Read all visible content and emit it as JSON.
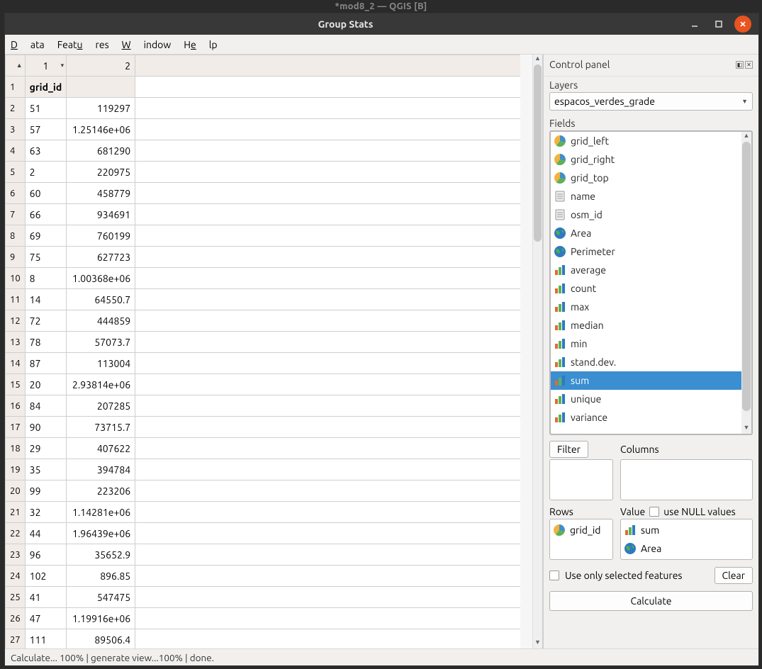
{
  "outer_title": "*mod8_2 — QGIS [B]",
  "window_title": "Group Stats",
  "menu": {
    "data": "Data",
    "features": "Features",
    "window": "Window",
    "help": "Help"
  },
  "cols": {
    "c1": "1",
    "c2": "2"
  },
  "header_row": {
    "idx": "1",
    "label": "grid_id"
  },
  "rows": [
    {
      "n": "2",
      "a": "51",
      "b": "119297"
    },
    {
      "n": "3",
      "a": "57",
      "b": "1.25146e+06"
    },
    {
      "n": "4",
      "a": "63",
      "b": "681290"
    },
    {
      "n": "5",
      "a": "2",
      "b": "220975"
    },
    {
      "n": "6",
      "a": "60",
      "b": "458779"
    },
    {
      "n": "7",
      "a": "66",
      "b": "934691"
    },
    {
      "n": "8",
      "a": "69",
      "b": "760199"
    },
    {
      "n": "9",
      "a": "75",
      "b": "627723"
    },
    {
      "n": "10",
      "a": "8",
      "b": "1.00368e+06"
    },
    {
      "n": "11",
      "a": "14",
      "b": "64550.7"
    },
    {
      "n": "12",
      "a": "72",
      "b": "444859"
    },
    {
      "n": "13",
      "a": "78",
      "b": "57073.7"
    },
    {
      "n": "14",
      "a": "87",
      "b": "113004"
    },
    {
      "n": "15",
      "a": "20",
      "b": "2.93814e+06"
    },
    {
      "n": "16",
      "a": "84",
      "b": "207285"
    },
    {
      "n": "17",
      "a": "90",
      "b": "73715.7"
    },
    {
      "n": "18",
      "a": "29",
      "b": "407622"
    },
    {
      "n": "19",
      "a": "35",
      "b": "394784"
    },
    {
      "n": "20",
      "a": "99",
      "b": "223206"
    },
    {
      "n": "21",
      "a": "32",
      "b": "1.14281e+06"
    },
    {
      "n": "22",
      "a": "44",
      "b": "1.96439e+06"
    },
    {
      "n": "23",
      "a": "96",
      "b": "35652.9"
    },
    {
      "n": "24",
      "a": "102",
      "b": "896.85"
    },
    {
      "n": "25",
      "a": "41",
      "b": "547475"
    },
    {
      "n": "26",
      "a": "47",
      "b": "1.19916e+06"
    },
    {
      "n": "27",
      "a": "111",
      "b": "89506.4"
    }
  ],
  "panel": {
    "title": "Control panel",
    "layers_label": "Layers",
    "layer_selected": "espacos_verdes_grade",
    "fields_label": "Fields",
    "filter_label": "Filter",
    "columns_label": "Columns",
    "rows_label": "Rows",
    "value_label": "Value",
    "use_null": "use NULL values",
    "use_sel": "Use only selected features",
    "clear": "Clear",
    "calculate": "Calculate"
  },
  "fields": [
    {
      "icon": "pie",
      "label": "grid_left"
    },
    {
      "icon": "pie",
      "label": "grid_right"
    },
    {
      "icon": "pie",
      "label": "grid_top"
    },
    {
      "icon": "doc",
      "label": "name"
    },
    {
      "icon": "doc",
      "label": "osm_id"
    },
    {
      "icon": "globe",
      "label": "Area"
    },
    {
      "icon": "globe",
      "label": "Perimeter"
    },
    {
      "icon": "bars",
      "label": "average"
    },
    {
      "icon": "bars",
      "label": "count"
    },
    {
      "icon": "bars",
      "label": "max"
    },
    {
      "icon": "bars",
      "label": "median"
    },
    {
      "icon": "bars",
      "label": "min"
    },
    {
      "icon": "bars",
      "label": "stand.dev."
    },
    {
      "icon": "bars",
      "label": "sum",
      "selected": true
    },
    {
      "icon": "bars",
      "label": "unique"
    },
    {
      "icon": "bars",
      "label": "variance"
    }
  ],
  "drop_rows": [
    {
      "icon": "pie",
      "label": "grid_id"
    }
  ],
  "drop_value": [
    {
      "icon": "bars",
      "label": "sum"
    },
    {
      "icon": "globe",
      "label": "Area"
    }
  ],
  "status": "Calculate... 100% |  generate view...100% |  done."
}
